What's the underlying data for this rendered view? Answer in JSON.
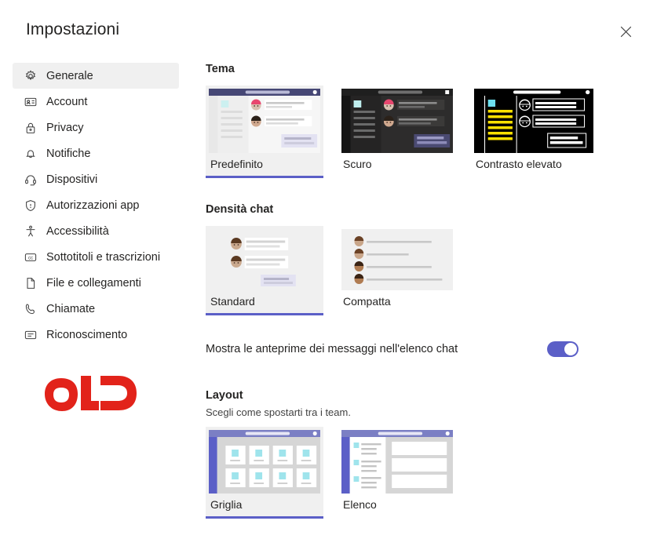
{
  "dialog": {
    "title": "Impostazioni",
    "close_label": "Chiudi"
  },
  "sidebar": {
    "items": [
      {
        "label": "Generale",
        "icon": "gear-icon",
        "selected": true
      },
      {
        "label": "Account",
        "icon": "id-card-icon",
        "selected": false
      },
      {
        "label": "Privacy",
        "icon": "lock-icon",
        "selected": false
      },
      {
        "label": "Notifiche",
        "icon": "bell-icon",
        "selected": false
      },
      {
        "label": "Dispositivi",
        "icon": "headset-icon",
        "selected": false
      },
      {
        "label": "Autorizzazioni app",
        "icon": "shield-icon",
        "selected": false
      },
      {
        "label": "Accessibilità",
        "icon": "accessibility-icon",
        "selected": false
      },
      {
        "label": "Sottotitoli e trascrizioni",
        "icon": "cc-icon",
        "selected": false
      },
      {
        "label": "File e collegamenti",
        "icon": "document-icon",
        "selected": false
      },
      {
        "label": "Chiamate",
        "icon": "phone-icon",
        "selected": false
      },
      {
        "label": "Riconoscimento",
        "icon": "recognition-icon",
        "selected": false
      }
    ]
  },
  "watermark": {
    "text": "OLD",
    "color": "#e2231a"
  },
  "theme": {
    "title": "Tema",
    "options": [
      {
        "label": "Predefinito",
        "selected": true
      },
      {
        "label": "Scuro",
        "selected": false
      },
      {
        "label": "Contrasto elevato",
        "selected": false
      }
    ]
  },
  "density": {
    "title": "Densità chat",
    "options": [
      {
        "label": "Standard",
        "selected": true
      },
      {
        "label": "Compatta",
        "selected": false
      }
    ]
  },
  "previews": {
    "label": "Mostra le anteprime dei messaggi nell'elenco chat",
    "enabled": true
  },
  "layout": {
    "title": "Layout",
    "subtitle": "Scegli come spostarti tra i team.",
    "options": [
      {
        "label": "Griglia",
        "selected": true
      },
      {
        "label": "Elenco",
        "selected": false
      }
    ]
  },
  "colors": {
    "accent": "#5b5fc7",
    "accent_dark": "#464775",
    "selected_bg": "#f0f0f0",
    "brand_red": "#e2231a"
  }
}
